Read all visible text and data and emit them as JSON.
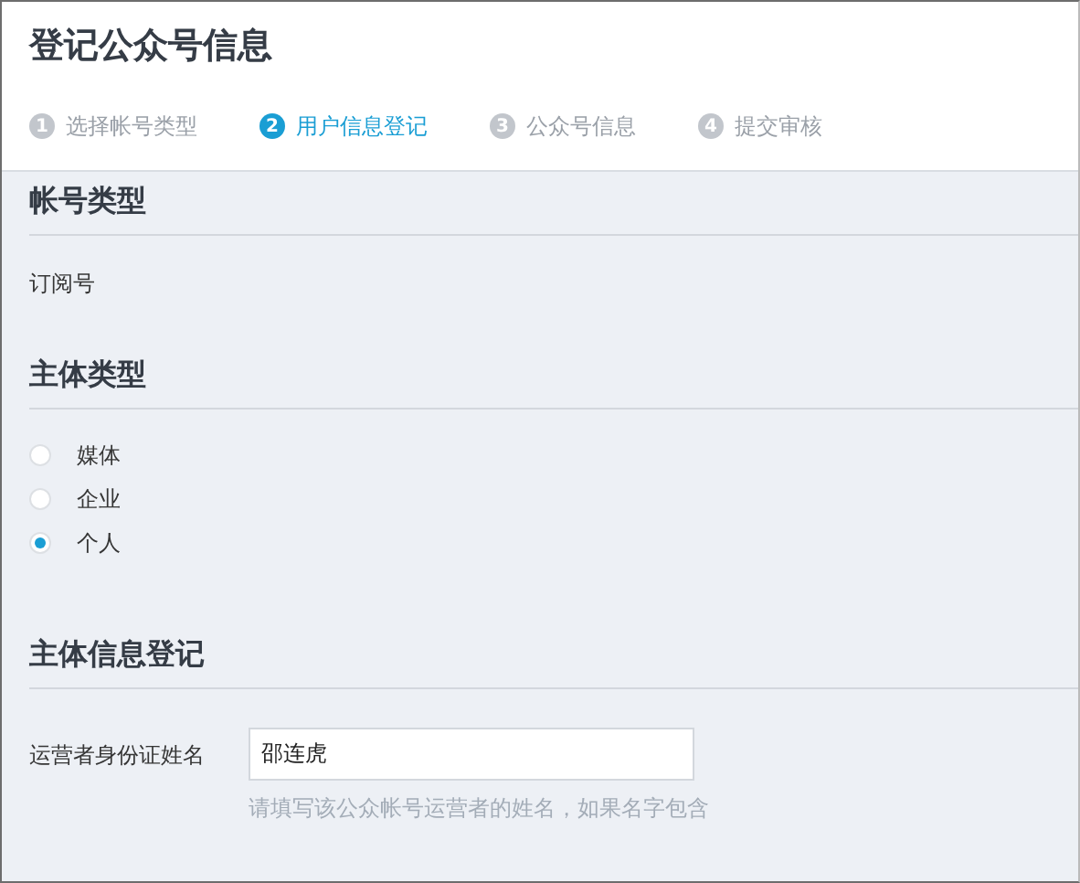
{
  "page_title": "登记公众号信息",
  "steps": [
    {
      "number": "1",
      "label": "选择帐号类型",
      "selected": false
    },
    {
      "number": "2",
      "label": "用户信息登记",
      "selected": true
    },
    {
      "number": "3",
      "label": "公众号信息",
      "selected": false
    },
    {
      "number": "4",
      "label": "提交审核",
      "selected": false
    }
  ],
  "account_type": {
    "heading": "帐号类型",
    "value": "订阅号"
  },
  "subject_type": {
    "heading": "主体类型",
    "options": [
      {
        "label": "媒体",
        "selected": false
      },
      {
        "label": "企业",
        "selected": false
      },
      {
        "label": "个人",
        "selected": true
      }
    ]
  },
  "subject_info": {
    "heading": "主体信息登记",
    "fields": [
      {
        "label": "运营者身份证姓名",
        "value": "邵连虎",
        "hint": "请填写该公众帐号运营者的姓名，如果名字包含"
      }
    ]
  }
}
